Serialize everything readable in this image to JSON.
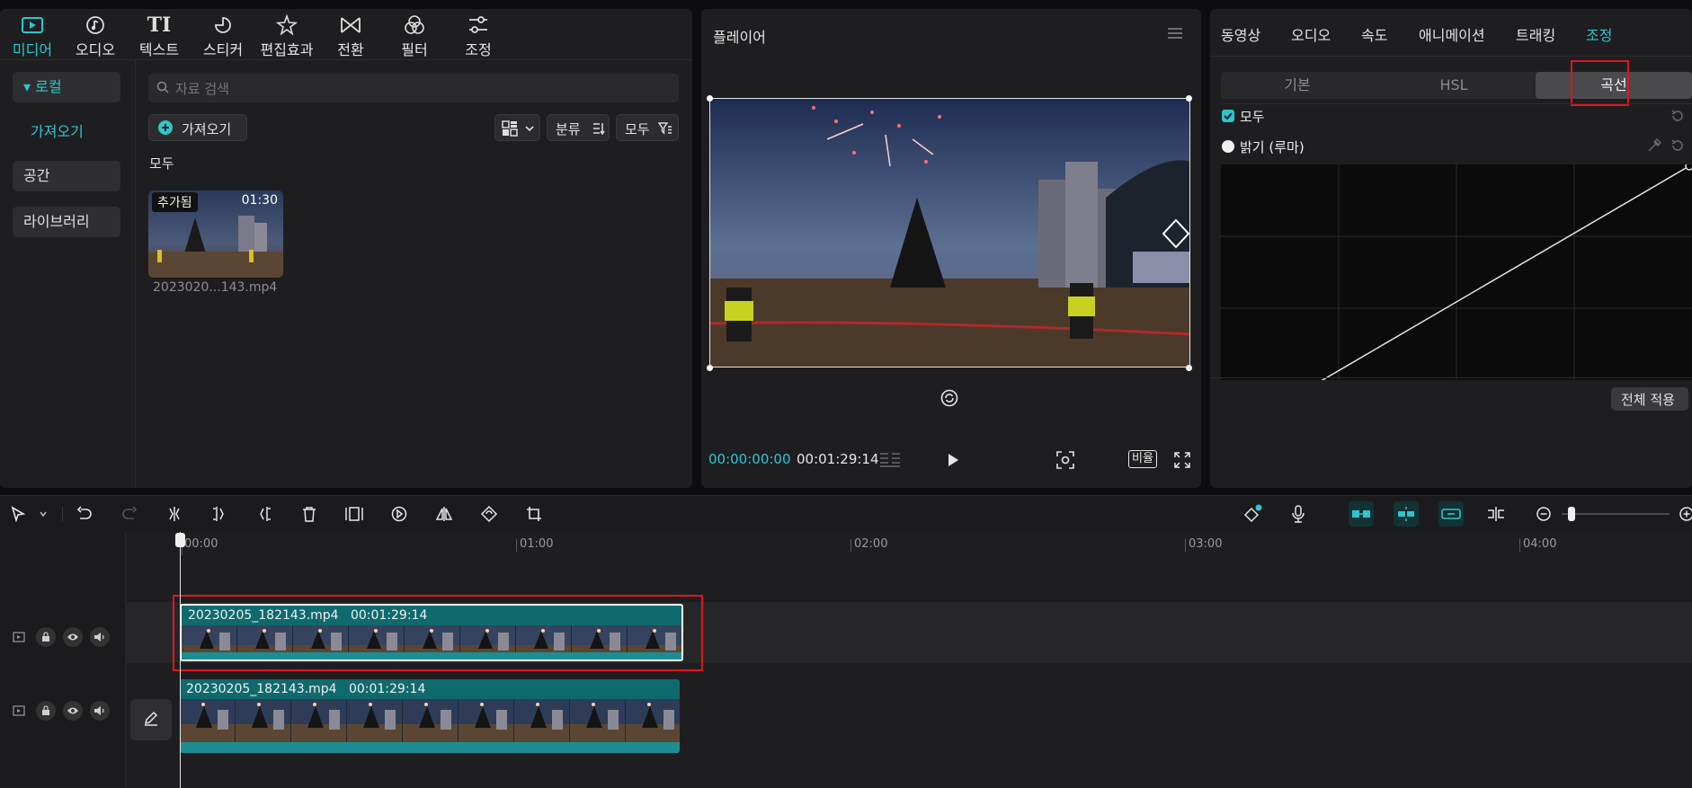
{
  "top_tabs": [
    {
      "label": "미디어",
      "icon": "media-icon"
    },
    {
      "label": "오디오",
      "icon": "music-icon"
    },
    {
      "label": "텍스트",
      "icon": "text-icon",
      "glyph": "TI"
    },
    {
      "label": "스티커",
      "icon": "sticker-icon"
    },
    {
      "label": "편집효과",
      "icon": "effects-icon"
    },
    {
      "label": "전환",
      "icon": "transition-icon"
    },
    {
      "label": "필터",
      "icon": "filter-icon"
    },
    {
      "label": "조정",
      "icon": "adjust-icon"
    }
  ],
  "sidebar": {
    "items": [
      {
        "label": "▾ 로컬"
      },
      {
        "label": "가져오기"
      },
      {
        "label": "공간"
      },
      {
        "label": "라이브러리"
      }
    ]
  },
  "media": {
    "search_placeholder": "자료 검색",
    "import_label": "가져오기",
    "sort_label": "분류",
    "filter_label": "모두",
    "section_label": "모두",
    "thumb": {
      "badge": "추가됨",
      "duration": "01:30",
      "filename": "2023020...143.mp4"
    }
  },
  "player": {
    "title": "플레이어",
    "current_time": "00:00:00:00",
    "total_time": "00:01:29:14",
    "ratio_label": "비율"
  },
  "adjust": {
    "tabs": [
      "동영상",
      "오디오",
      "속도",
      "애니메이션",
      "트래킹",
      "조정"
    ],
    "subtabs": [
      "기본",
      "HSL",
      "곡선"
    ],
    "all_label": "모두",
    "luma_label": "밝기 (루마)",
    "apply_all": "전체 적용"
  },
  "timeline": {
    "ticks": [
      "00:00",
      "01:00",
      "02:00",
      "03:00",
      "04:00"
    ],
    "clips": [
      {
        "name": "20230205_182143.mp4",
        "duration": "00:01:29:14"
      },
      {
        "name": "20230205_182143.mp4",
        "duration": "00:01:29:14"
      }
    ]
  },
  "colors": {
    "accent": "#2ec5cf",
    "highlight": "#e0161e",
    "clip": "#0f6a6e"
  }
}
